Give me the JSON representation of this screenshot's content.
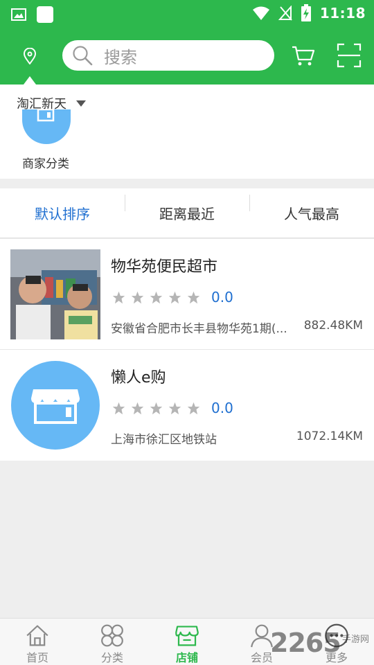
{
  "status_bar": {
    "time": "11:18"
  },
  "header": {
    "search_placeholder": "搜索"
  },
  "location": {
    "current": "淘汇新天"
  },
  "category": {
    "label": "商家分类"
  },
  "sort_tabs": [
    "默认排序",
    "距离最近",
    "人气最高"
  ],
  "stores": [
    {
      "name": "物华苑便民超市",
      "rating": "0.0",
      "address": "安徽省合肥市长丰县物华苑1期(...",
      "distance": "882.48KM"
    },
    {
      "name": "懒人e购",
      "rating": "0.0",
      "address": "上海市徐汇区地铁站",
      "distance": "1072.14KM"
    }
  ],
  "bottom_nav": [
    {
      "label": "首页",
      "icon": "home-icon"
    },
    {
      "label": "分类",
      "icon": "grid-icon"
    },
    {
      "label": "店铺",
      "icon": "store-icon"
    },
    {
      "label": "会员",
      "icon": "user-icon"
    },
    {
      "label": "更多",
      "icon": "more-icon"
    }
  ],
  "watermark": {
    "main": "2265",
    "sub": "手游网"
  },
  "colors": {
    "brand_green": "#2db84d",
    "accent_blue": "#1f6fd0",
    "store_icon_blue": "#66b8f5"
  }
}
